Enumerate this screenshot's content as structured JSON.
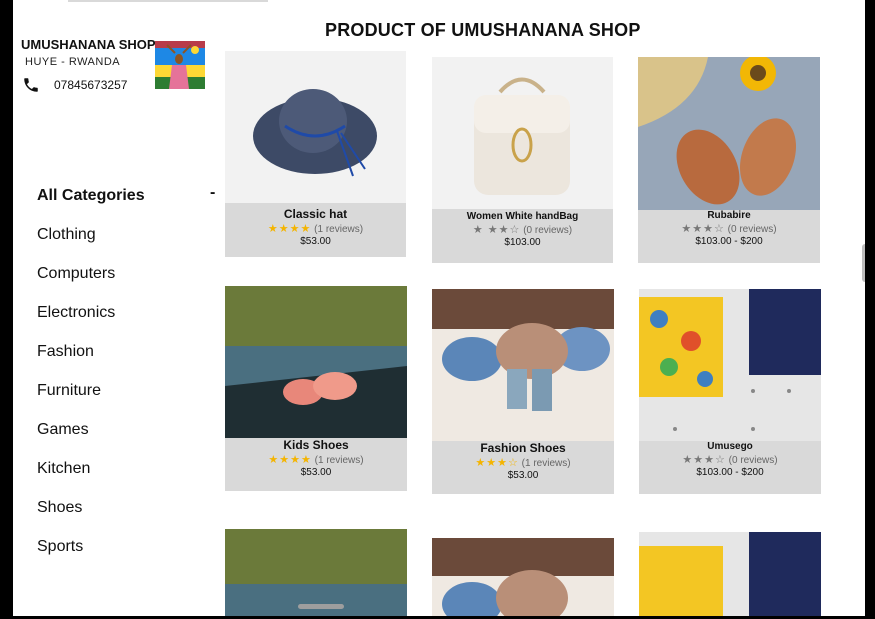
{
  "page_title": "PRODUCT OF UMUSHANANA SHOP",
  "shop": {
    "name": "UMUSHANANA SHOP",
    "location": "HUYE - RWANDA",
    "phone": "07845673257",
    "phone_icon": "phone-icon",
    "flag_image": "rwanda-flag-photo"
  },
  "categories": {
    "all_label": "All Categories",
    "toggle_label": "-",
    "items": [
      "Clothing",
      "Computers",
      "Electronics",
      "Fashion",
      "Furniture",
      "Games",
      "Kitchen",
      "Shoes",
      "Sports"
    ]
  },
  "products": [
    {
      "name": "Classic hat",
      "rating_stars": 4,
      "star_color": "gold",
      "reviews": "(1 reviews)",
      "price": "$53.00"
    },
    {
      "name": "Women White handBag",
      "rating_stars": 3.5,
      "star_color": "grey",
      "reviews": "(0 reviews)",
      "price": "$103.00"
    },
    {
      "name": "Rubabire",
      "rating_stars": 3.5,
      "star_color": "grey",
      "reviews": "(0 reviews)",
      "price": "$103.00 - $200"
    },
    {
      "name": "Kids  Shoes",
      "rating_stars": 4,
      "star_color": "gold",
      "reviews": "(1 reviews)",
      "price": "$53.00"
    },
    {
      "name": "Fashion Shoes",
      "rating_stars": 3.5,
      "star_color": "gold",
      "reviews": "(1 reviews)",
      "price": "$53.00"
    },
    {
      "name": "Umusego",
      "rating_stars": 3.5,
      "star_color": "grey",
      "reviews": "(0 reviews)",
      "price": "$103.00 - $200"
    }
  ],
  "colors": {
    "card_bg": "#d9d9d9",
    "star_gold": "#f4b400",
    "star_grey": "#777777"
  }
}
